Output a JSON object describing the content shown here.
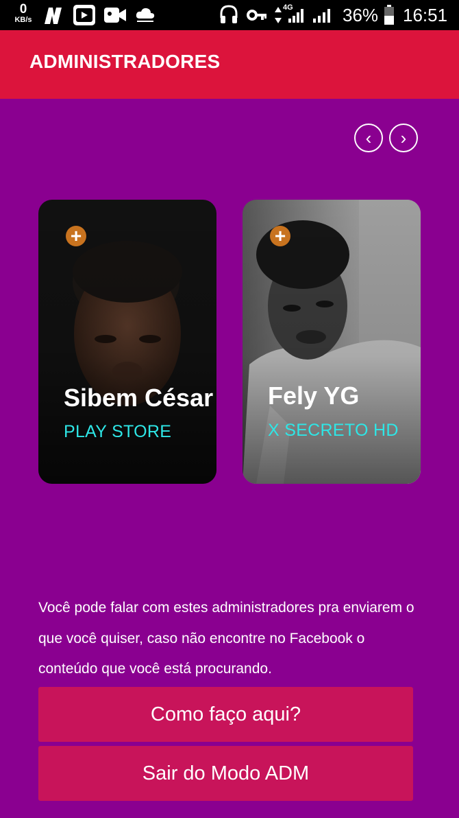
{
  "status_bar": {
    "speed_value": "0",
    "speed_unit": "KB/s",
    "network_type": "4G",
    "battery": "36%",
    "time": "16:51"
  },
  "app_bar": {
    "title": "ADMINISTRADORES"
  },
  "nav": {
    "prev": "‹",
    "next": "›"
  },
  "admins": [
    {
      "name": "Sibem César",
      "subtitle": "PLAY STORE"
    },
    {
      "name": "Fely YG",
      "subtitle": "X SECRETO HD"
    }
  ],
  "info_text": "Você pode falar com estes administradores pra enviarem o que você quiser, caso não encontre no Facebook o conteúdo que você está procurando.",
  "buttons": {
    "help_label": "Como faço aqui?",
    "exit_label": "Sair do Modo ADM"
  },
  "colors": {
    "background": "#8a0090",
    "app_bar": "#dc143c",
    "button": "#c8145a",
    "subtitle": "#2ee6e6"
  }
}
